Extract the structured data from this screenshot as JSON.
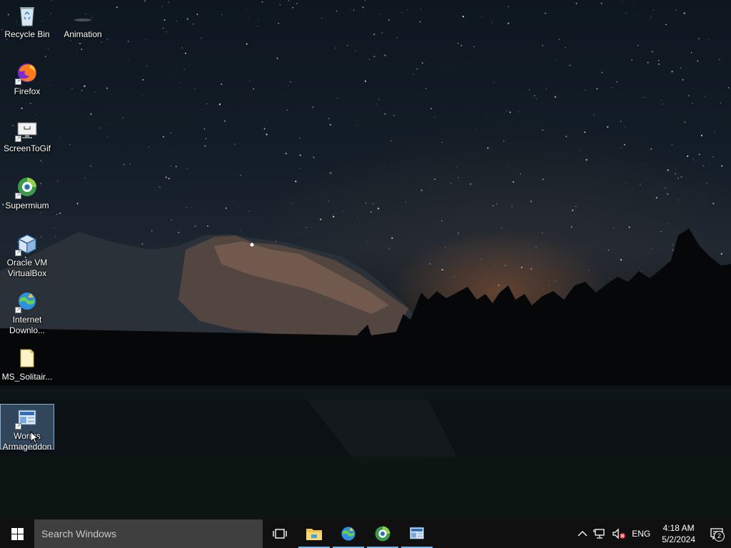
{
  "desktop": {
    "icons": [
      {
        "id": "recycle-bin",
        "label": "Recycle Bin",
        "icon": "recycle-bin-icon",
        "shortcut": false,
        "selected": false
      },
      {
        "id": "animation",
        "label": "Animation",
        "icon": "animation-icon",
        "shortcut": false,
        "selected": false
      },
      {
        "id": "firefox",
        "label": "Firefox",
        "icon": "firefox-icon",
        "shortcut": true,
        "selected": false
      },
      {
        "id": "screentogif",
        "label": "ScreenToGif",
        "icon": "screentogif-icon",
        "shortcut": true,
        "selected": false
      },
      {
        "id": "supermium",
        "label": "Supermium",
        "icon": "supermium-icon",
        "shortcut": true,
        "selected": false
      },
      {
        "id": "virtualbox",
        "label": "Oracle VM VirtualBox",
        "icon": "virtualbox-icon",
        "shortcut": true,
        "selected": false
      },
      {
        "id": "idm",
        "label": "Internet Downlo...",
        "icon": "internet-download-manager-icon",
        "shortcut": true,
        "selected": false
      },
      {
        "id": "ms-solitaire",
        "label": "MS_Solitair...",
        "icon": "folder-icon",
        "shortcut": false,
        "selected": false
      },
      {
        "id": "worms",
        "label": "Worms Armageddon",
        "icon": "worms-armageddon-icon",
        "shortcut": true,
        "selected": true
      }
    ]
  },
  "taskbar": {
    "search_placeholder": "Search Windows",
    "pinned": [
      {
        "id": "task-view",
        "icon": "task-view-icon",
        "running": false
      },
      {
        "id": "file-explorer",
        "icon": "file-explorer-icon",
        "running": true
      },
      {
        "id": "idm",
        "icon": "internet-download-manager-icon",
        "running": true
      },
      {
        "id": "supermium",
        "icon": "supermium-icon",
        "running": true
      },
      {
        "id": "worms",
        "icon": "worms-armageddon-icon",
        "running": true
      }
    ],
    "tray": {
      "language": "ENG",
      "time": "4:18 AM",
      "date": "5/2/2024",
      "notification_count": "2"
    }
  },
  "colors": {
    "taskbar": "#101010",
    "search_box": "#3f3f3f",
    "running_indicator": "#76b9ed",
    "selection": "#78aadc"
  }
}
